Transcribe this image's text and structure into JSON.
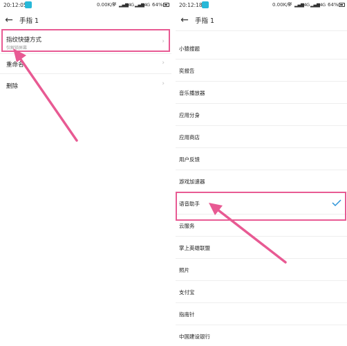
{
  "left": {
    "status": {
      "time": "20:12:05",
      "speed": "0.00K/s",
      "net1": "4G",
      "net2": "4G",
      "battery": "64%"
    },
    "title": "手指 1",
    "rows": [
      {
        "label": "指纹快捷方式",
        "sub": "仅解锁屏幕"
      },
      {
        "label": "重命名"
      },
      {
        "label": "删除"
      }
    ]
  },
  "right": {
    "status": {
      "time": "20:12:18",
      "speed": "0.00K/s",
      "net1": "4G",
      "net2": "4G",
      "battery": "64%"
    },
    "title": "手指 1",
    "items": [
      {
        "label": "小猿搜题"
      },
      {
        "label": "奕报告"
      },
      {
        "label": "音乐播放器"
      },
      {
        "label": "应用分身"
      },
      {
        "label": "应用商店"
      },
      {
        "label": "用户反馈"
      },
      {
        "label": "游戏加速器"
      },
      {
        "label": "语音助手",
        "selected": true
      },
      {
        "label": "云服务"
      },
      {
        "label": "掌上英雄联盟"
      },
      {
        "label": "照片"
      },
      {
        "label": "支付宝"
      },
      {
        "label": "指南针"
      },
      {
        "label": "中国建设银行"
      }
    ]
  },
  "colors": {
    "highlight": "#e85a93",
    "accent": "#2a93d8",
    "notification": "#28b8d8"
  }
}
